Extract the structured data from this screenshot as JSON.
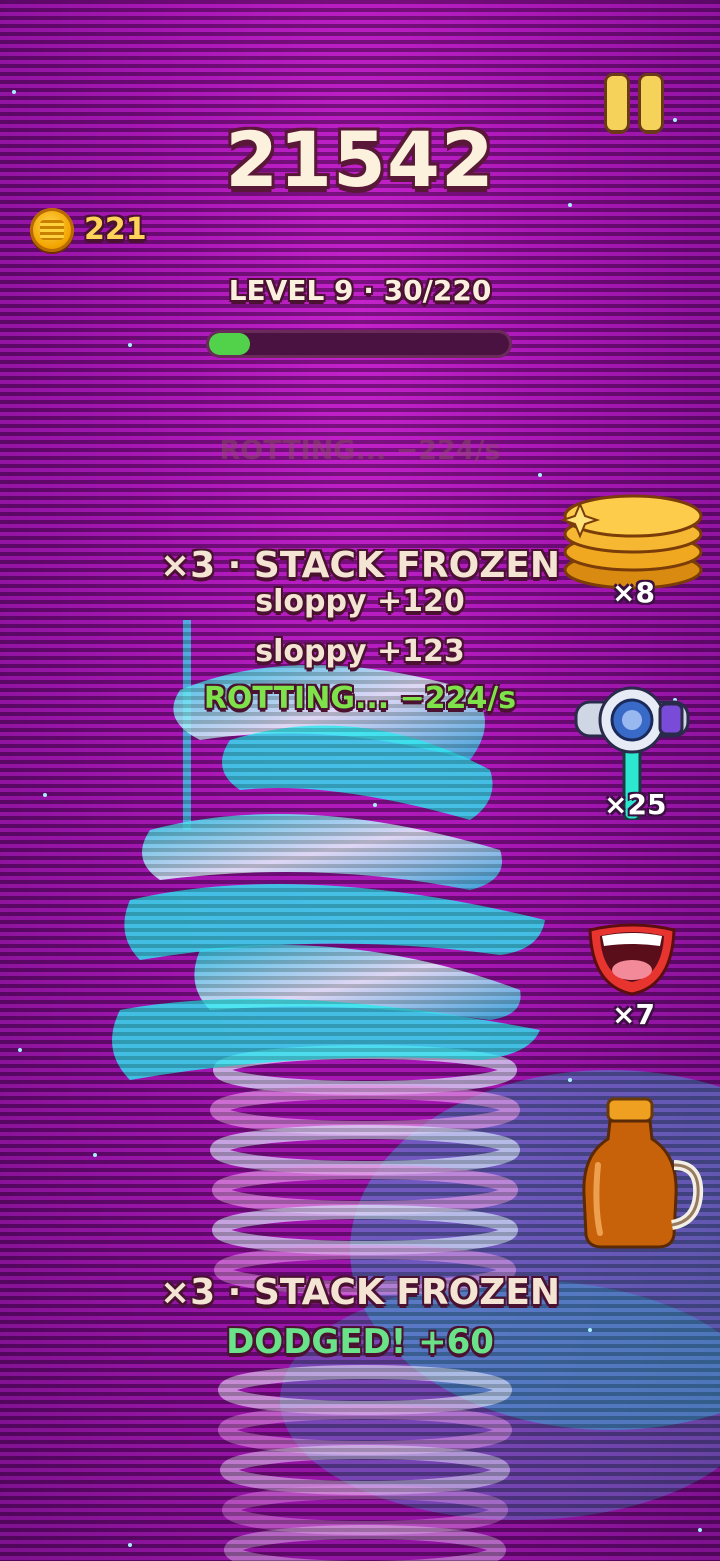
{
  "hud": {
    "score": "21542",
    "coins": "221",
    "level_text": "LEVEL 9  ·  30/220",
    "level_progress": 0.136
  },
  "floating_texts": {
    "rotting_faded": "ROTTING...  −224/s",
    "combo_top": "×3  ·  STACK FROZEN",
    "sloppy_1": "sloppy  +120",
    "sloppy_2": "sloppy  +123",
    "rotting": "ROTTING...  −224/s",
    "combo_bottom": "×3  ·  STACK FROZEN",
    "dodged": "DODGED!  +60"
  },
  "powerups": [
    {
      "name": "pancake-stack",
      "count": "×8"
    },
    {
      "name": "freeze-ray",
      "count": "×25"
    },
    {
      "name": "mouth",
      "count": "×7"
    },
    {
      "name": "syrup-bottle",
      "count": ""
    }
  ],
  "colors": {
    "background": "#a20fb0",
    "stack_cyan": "#2ce8f0",
    "progress_fill": "#52d24a",
    "score_text": "#fbf1dc"
  }
}
